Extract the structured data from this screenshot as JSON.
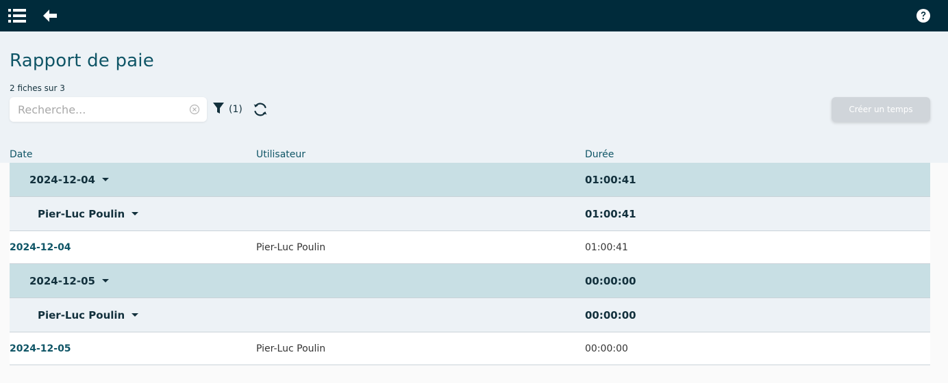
{
  "header": {
    "menu_icon": "menu-list-icon",
    "back_icon": "arrow-left-icon",
    "help_icon": "question-circle-icon"
  },
  "page": {
    "title": "Rapport de paie",
    "count": "2 fiches sur 3"
  },
  "search": {
    "placeholder": "Recherche...",
    "value": ""
  },
  "filter": {
    "count_label": "(1)"
  },
  "actions": {
    "create_label": "Créer un temps"
  },
  "table": {
    "columns": [
      "Date",
      "Utilisateur",
      "Durée"
    ],
    "groups": [
      {
        "date": "2024-12-04",
        "total": "01:00:41",
        "subgroup": {
          "user": "Pier-Luc Poulin",
          "total": "01:00:41"
        },
        "rows": [
          {
            "date": "2024-12-04",
            "user": "Pier-Luc Poulin",
            "duration": "01:00:41"
          }
        ]
      },
      {
        "date": "2024-12-05",
        "total": "00:00:00",
        "subgroup": {
          "user": "Pier-Luc Poulin",
          "total": "00:00:00"
        },
        "rows": [
          {
            "date": "2024-12-05",
            "user": "Pier-Luc Poulin",
            "duration": "00:00:00"
          }
        ]
      }
    ]
  },
  "colors": {
    "topbar": "#002b3b",
    "header_bg": "#edf2f6",
    "group_bg": "#c8dfe4",
    "subgroup_bg": "#edf2f6",
    "accent": "#0f5566"
  }
}
